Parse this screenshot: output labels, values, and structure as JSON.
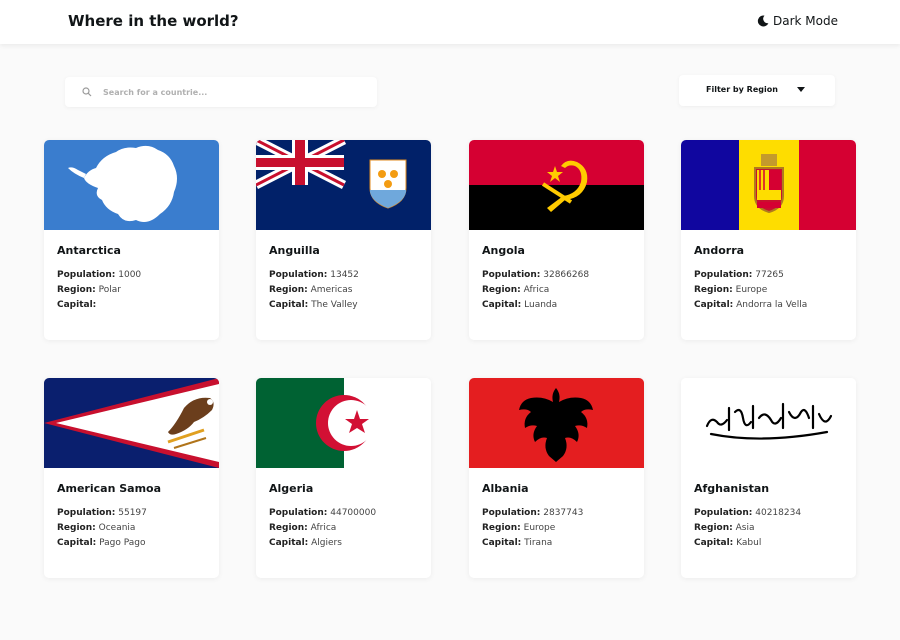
{
  "header": {
    "title": "Where in the world?",
    "theme_toggle_label": "Dark Mode"
  },
  "search": {
    "placeholder": "Search for a countrie...",
    "value": ""
  },
  "filter": {
    "label": "Filter by Region"
  },
  "labels": {
    "population": "Population:",
    "region": "Region:",
    "capital": "Capital:"
  },
  "countries": [
    {
      "name": "Antarctica",
      "population": "1000",
      "region": "Polar",
      "capital": ""
    },
    {
      "name": "Anguilla",
      "population": "13452",
      "region": "Americas",
      "capital": "The Valley"
    },
    {
      "name": "Angola",
      "population": "32866268",
      "region": "Africa",
      "capital": "Luanda"
    },
    {
      "name": "Andorra",
      "population": "77265",
      "region": "Europe",
      "capital": "Andorra la Vella"
    },
    {
      "name": "American Samoa",
      "population": "55197",
      "region": "Oceania",
      "capital": "Pago Pago"
    },
    {
      "name": "Algeria",
      "population": "44700000",
      "region": "Africa",
      "capital": "Algiers"
    },
    {
      "name": "Albania",
      "population": "2837743",
      "region": "Europe",
      "capital": "Tirana"
    },
    {
      "name": "Afghanistan",
      "population": "40218234",
      "region": "Asia",
      "capital": "Kabul"
    }
  ],
  "colors": {
    "background": "#fafafa",
    "surface": "#ffffff",
    "text": "#111517"
  }
}
